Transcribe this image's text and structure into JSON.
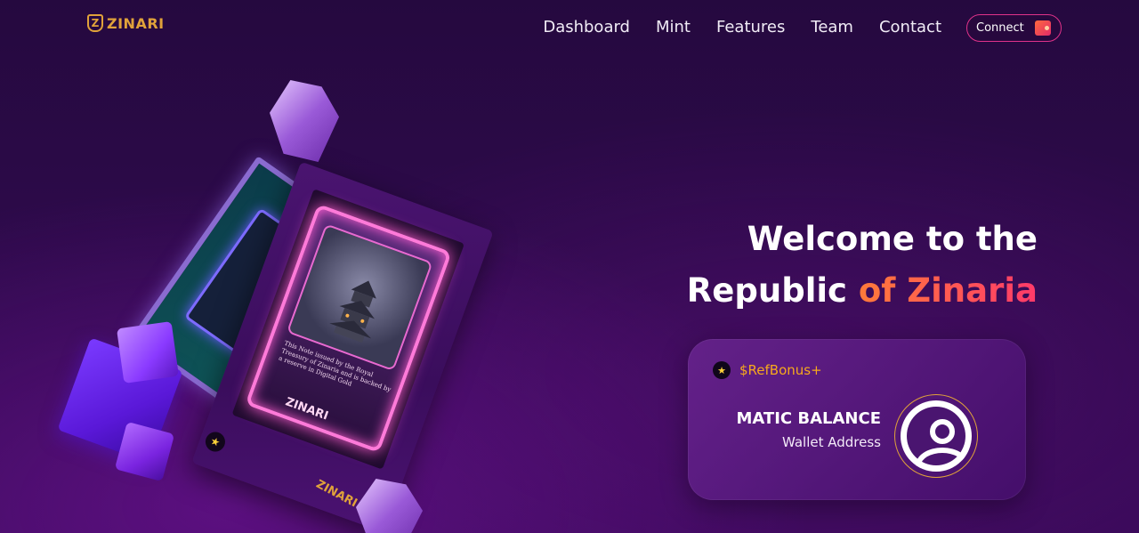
{
  "header": {
    "logo_text": "ZINARI",
    "logo_mark": "Z",
    "nav": [
      "Dashboard",
      "Mint",
      "Features",
      "Team",
      "Contact"
    ],
    "connect_label": "Connect",
    "connect_icon": "wallet-icon"
  },
  "hero": {
    "title_line1": "Welcome to the",
    "title_line2_plain": "Republic ",
    "title_line2_accent": "of Zinaria"
  },
  "art": {
    "card_text": "This Note issued by the Royal Treasury of Zinaria and is backed by a reserve in Digital Gold",
    "card_logo": "ZINARI",
    "card_brand": "ZINARI",
    "card_star": "★"
  },
  "balance_card": {
    "bonus_icon": "★",
    "bonus_text": "$RefBonus+",
    "matic_label": "MATIC BALANCE",
    "wallet_address_label": "Wallet Address",
    "avatar_icon": "user-avatar-icon"
  },
  "colors": {
    "brand_gold": "#e0a23a",
    "accent_gradient_start": "#ff7a3a",
    "accent_gradient_end": "#ff3a6a",
    "connect_border": "#e0328a",
    "bonus_orange": "#f7a91c",
    "background": "#2d0a4a"
  }
}
